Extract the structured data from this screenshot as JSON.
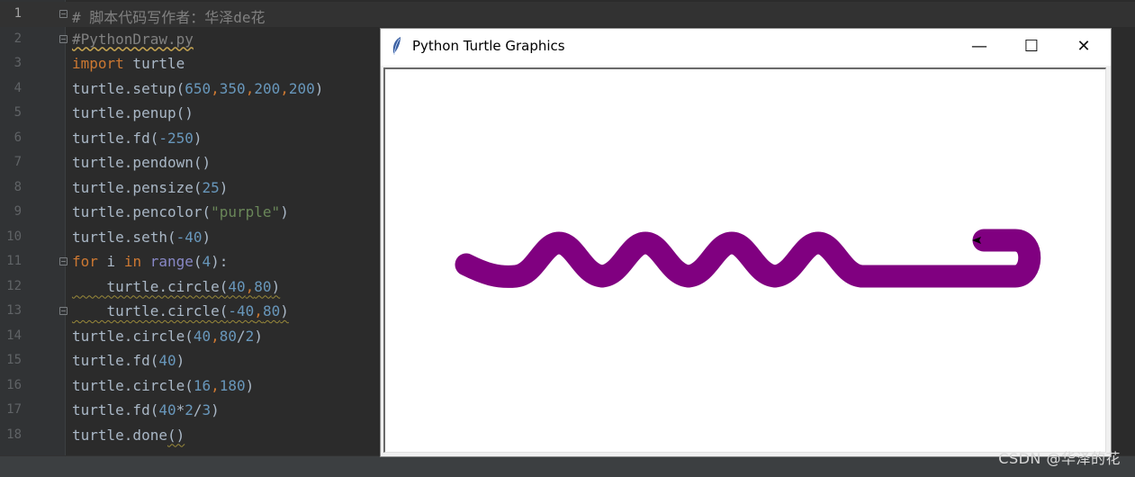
{
  "editor": {
    "current_line": 1,
    "lines": [
      {
        "n": "1",
        "tokens": [
          {
            "t": "# 脚本代码写作者：华泽de花",
            "c": "c-comment"
          }
        ]
      },
      {
        "n": "2",
        "tokens": [
          {
            "t": "#PythonDraw.py",
            "c": "c-comment wavy"
          }
        ]
      },
      {
        "n": "3",
        "tokens": [
          {
            "t": "import",
            "c": "c-kw"
          },
          {
            "t": " turtle",
            "c": "c-text"
          }
        ]
      },
      {
        "n": "4",
        "tokens": [
          {
            "t": "turtle.setup(",
            "c": "c-text"
          },
          {
            "t": "650",
            "c": "c-num"
          },
          {
            "t": ",",
            "c": "c-kw"
          },
          {
            "t": "350",
            "c": "c-num"
          },
          {
            "t": ",",
            "c": "c-kw"
          },
          {
            "t": "200",
            "c": "c-num"
          },
          {
            "t": ",",
            "c": "c-kw"
          },
          {
            "t": "200",
            "c": "c-num"
          },
          {
            "t": ")",
            "c": "c-text"
          }
        ]
      },
      {
        "n": "5",
        "tokens": [
          {
            "t": "turtle.penup()",
            "c": "c-text"
          }
        ]
      },
      {
        "n": "6",
        "tokens": [
          {
            "t": "turtle.fd(",
            "c": "c-text"
          },
          {
            "t": "-250",
            "c": "c-num"
          },
          {
            "t": ")",
            "c": "c-text"
          }
        ]
      },
      {
        "n": "7",
        "tokens": [
          {
            "t": "turtle.pendown()",
            "c": "c-text"
          }
        ]
      },
      {
        "n": "8",
        "tokens": [
          {
            "t": "turtle.pensize(",
            "c": "c-text"
          },
          {
            "t": "25",
            "c": "c-num"
          },
          {
            "t": ")",
            "c": "c-text"
          }
        ]
      },
      {
        "n": "9",
        "tokens": [
          {
            "t": "turtle.pencolor(",
            "c": "c-text"
          },
          {
            "t": "\"purple\"",
            "c": "c-str"
          },
          {
            "t": ")",
            "c": "c-text"
          }
        ]
      },
      {
        "n": "10",
        "tokens": [
          {
            "t": "turtle.seth(",
            "c": "c-text"
          },
          {
            "t": "-40",
            "c": "c-num"
          },
          {
            "t": ")",
            "c": "c-text"
          }
        ]
      },
      {
        "n": "11",
        "tokens": [
          {
            "t": "for",
            "c": "c-kw"
          },
          {
            "t": " i ",
            "c": "c-text"
          },
          {
            "t": "in",
            "c": "c-kw"
          },
          {
            "t": " ",
            "c": "c-text"
          },
          {
            "t": "range",
            "c": "c-builtin"
          },
          {
            "t": "(",
            "c": "c-text"
          },
          {
            "t": "4",
            "c": "c-num"
          },
          {
            "t": "):",
            "c": "c-text"
          }
        ]
      },
      {
        "n": "12",
        "tokens": [
          {
            "t": "    turtle.circle(",
            "c": "c-text wavy-under"
          },
          {
            "t": "40",
            "c": "c-num wavy-under"
          },
          {
            "t": ",",
            "c": "c-kw wavy-under"
          },
          {
            "t": "80",
            "c": "c-num wavy-under"
          },
          {
            "t": ")",
            "c": "c-text wavy-under"
          }
        ]
      },
      {
        "n": "13",
        "tokens": [
          {
            "t": "    turtle.circle(",
            "c": "c-text wavy-under"
          },
          {
            "t": "-40",
            "c": "c-num wavy-under"
          },
          {
            "t": ",",
            "c": "c-kw wavy-under"
          },
          {
            "t": "80",
            "c": "c-num wavy-under"
          },
          {
            "t": ")",
            "c": "c-text wavy-under"
          }
        ]
      },
      {
        "n": "14",
        "tokens": [
          {
            "t": "turtle.circle(",
            "c": "c-text"
          },
          {
            "t": "40",
            "c": "c-num"
          },
          {
            "t": ",",
            "c": "c-kw"
          },
          {
            "t": "80",
            "c": "c-num"
          },
          {
            "t": "/",
            "c": "c-text"
          },
          {
            "t": "2",
            "c": "c-num"
          },
          {
            "t": ")",
            "c": "c-text"
          }
        ]
      },
      {
        "n": "15",
        "tokens": [
          {
            "t": "turtle.fd(",
            "c": "c-text"
          },
          {
            "t": "40",
            "c": "c-num"
          },
          {
            "t": ")",
            "c": "c-text"
          }
        ]
      },
      {
        "n": "16",
        "tokens": [
          {
            "t": "turtle.circle(",
            "c": "c-text"
          },
          {
            "t": "16",
            "c": "c-num"
          },
          {
            "t": ",",
            "c": "c-kw"
          },
          {
            "t": "180",
            "c": "c-num"
          },
          {
            "t": ")",
            "c": "c-text"
          }
        ]
      },
      {
        "n": "17",
        "tokens": [
          {
            "t": "turtle.fd(",
            "c": "c-text"
          },
          {
            "t": "40",
            "c": "c-num"
          },
          {
            "t": "*",
            "c": "c-text"
          },
          {
            "t": "2",
            "c": "c-num"
          },
          {
            "t": "/",
            "c": "c-text"
          },
          {
            "t": "3",
            "c": "c-num"
          },
          {
            "t": ")",
            "c": "c-text"
          }
        ]
      },
      {
        "n": "18",
        "tokens": [
          {
            "t": "turtle.done",
            "c": "c-text"
          },
          {
            "t": "()",
            "c": "c-text wavy-under"
          }
        ]
      }
    ],
    "fold_lines": [
      1,
      2,
      11,
      13
    ]
  },
  "turtle_window": {
    "title": "Python Turtle Graphics",
    "minimize_glyph": "—",
    "maximize_glyph": "☐",
    "close_glyph": "✕",
    "pen_color": "#800080",
    "icon": "feather-icon"
  },
  "watermark": "CSDN @华泽的花"
}
